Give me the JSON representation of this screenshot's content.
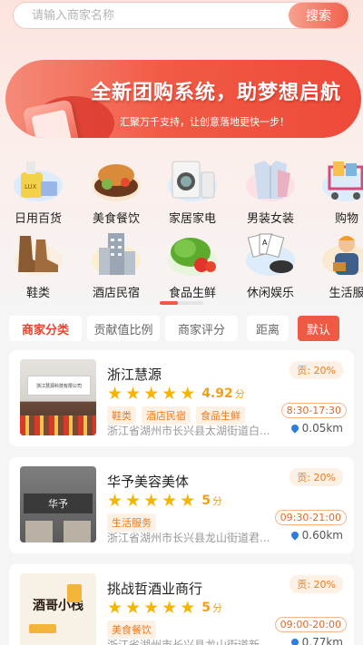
{
  "search": {
    "placeholder": "请输入商家名称",
    "button_label": "搜索"
  },
  "banner": {
    "title": "全新团购系统，助梦想启航",
    "subtitle": "汇聚万千支持，让创意落地更快一步！"
  },
  "categories": [
    {
      "label": "日用百货",
      "icon": "daily-goods-icon"
    },
    {
      "label": "美食餐饮",
      "icon": "food-icon"
    },
    {
      "label": "家居家电",
      "icon": "appliance-icon"
    },
    {
      "label": "男装女装",
      "icon": "clothing-icon"
    },
    {
      "label": "购物",
      "icon": "shopping-cart-icon"
    },
    {
      "label": "鞋类",
      "icon": "shoes-icon"
    },
    {
      "label": "酒店民宿",
      "icon": "hotel-icon"
    },
    {
      "label": "食品生鲜",
      "icon": "fresh-food-icon"
    },
    {
      "label": "休闲娱乐",
      "icon": "entertainment-icon"
    },
    {
      "label": "生活服",
      "icon": "life-service-icon"
    }
  ],
  "filters": {
    "category": "商家分类",
    "contribution": "贡献值比例",
    "rating": "商家评分",
    "distance": "距离",
    "default": "默认"
  },
  "merchants": [
    {
      "name": "浙江慧源",
      "score": "4.92",
      "score_unit": "分",
      "tags": [
        "鞋类",
        "酒店民宿",
        "食品生鲜"
      ],
      "address": "浙江省湖州市长兴县太湖街道白...",
      "contribution": "贡: 20%",
      "hours": "8:30-17:30",
      "distance": "0.05km",
      "image_text": "浙江慧源科技有限公司"
    },
    {
      "name": "华予美容美体",
      "score": "5",
      "score_unit": "分",
      "tags": [
        "生活服务"
      ],
      "address": "浙江省湖州市长兴县龙山街道君...",
      "contribution": "贡: 20%",
      "hours": "09:30-21:00",
      "distance": "0.60km",
      "image_text": "华予"
    },
    {
      "name": "挑战哲酒业商行",
      "score": "5",
      "score_unit": "分",
      "tags": [
        "美食餐饮"
      ],
      "address": "浙江省湖州市长兴县龙山街道新...",
      "contribution": "贡: 20%",
      "hours": "09:00-20:00",
      "distance": "0.77km",
      "image_text": "酒哥小栈"
    }
  ],
  "colors": {
    "accent": "#ef5a44",
    "star": "#f7b500",
    "tag_text": "#ef7c20"
  }
}
